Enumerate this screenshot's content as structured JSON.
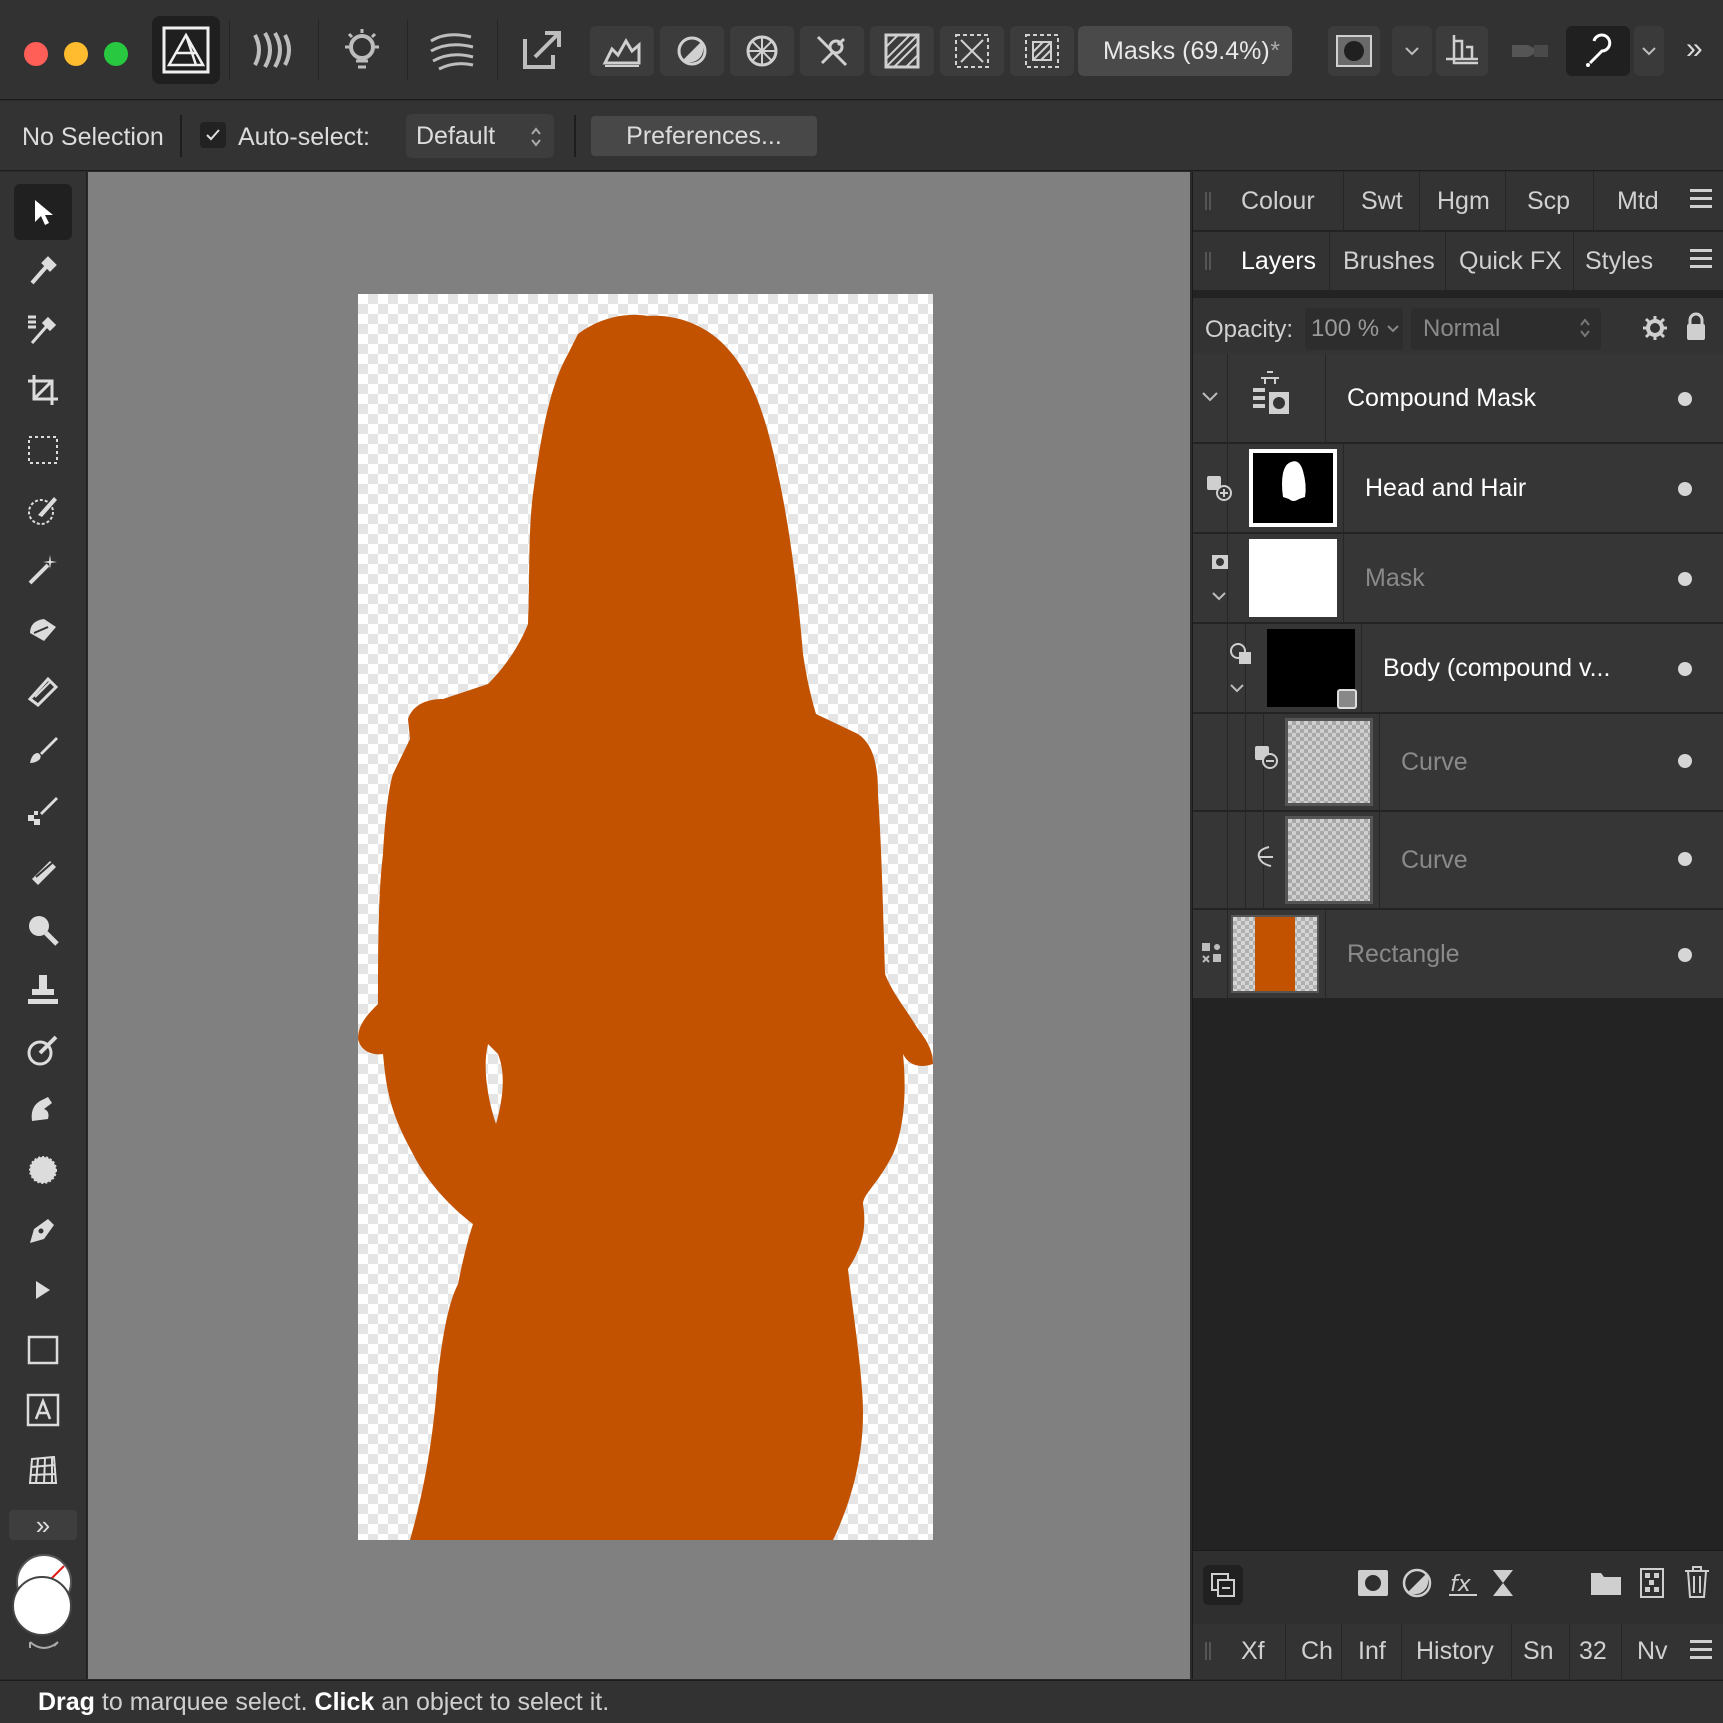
{
  "toolbar": {
    "document_title": "Masks (69.4%)",
    "unsaved_marker": "*",
    "overflow": "»"
  },
  "context_bar": {
    "selection_status": "No Selection",
    "auto_select_label": "Auto-select:",
    "auto_select_checked": true,
    "auto_select_value": "Default",
    "preferences_label": "Preferences..."
  },
  "tools": {
    "more_tools": "»",
    "items": [
      "move-tool",
      "color-picker-tool",
      "sample-picker-tool",
      "crop-tool",
      "marquee-tool",
      "selection-brush-tool",
      "flood-select-tool",
      "erase-brush-tool",
      "fill-tool",
      "paint-brush-tool",
      "pixel-tool",
      "inpainting-tool",
      "zoom-tool",
      "clone-tool",
      "dodge-tool",
      "smudge-tool",
      "blur-tool",
      "pen-tool",
      "node-tool",
      "rectangle-tool",
      "text-tool",
      "mesh-tool"
    ]
  },
  "top_panel_tabs": [
    "Colour",
    "Swt",
    "Hgm",
    "Scp",
    "Mtd"
  ],
  "layer_panel_tabs": [
    "Layers",
    "Brushes",
    "Quick FX",
    "Styles"
  ],
  "layer_controls": {
    "opacity_label": "Opacity:",
    "opacity_value": "100 %",
    "blend_mode": "Normal"
  },
  "layers": [
    {
      "name": "Compound Mask"
    },
    {
      "name": "Head and Hair"
    },
    {
      "name": "Mask"
    },
    {
      "name": "Body (compound v..."
    },
    {
      "name": "Curve"
    },
    {
      "name": "Curve"
    },
    {
      "name": "Rectangle"
    }
  ],
  "bottom_panel_tabs": [
    "Xf",
    "Ch",
    "Inf",
    "History",
    "Sn",
    "32",
    "Nv"
  ],
  "status": {
    "drag": "Drag",
    "drag_text": " to marquee select. ",
    "click": "Click",
    "click_text": " an object to select it."
  },
  "colors": {
    "silhouette": "#c25200",
    "panel": "#333333",
    "canvas_bg": "#808080"
  }
}
